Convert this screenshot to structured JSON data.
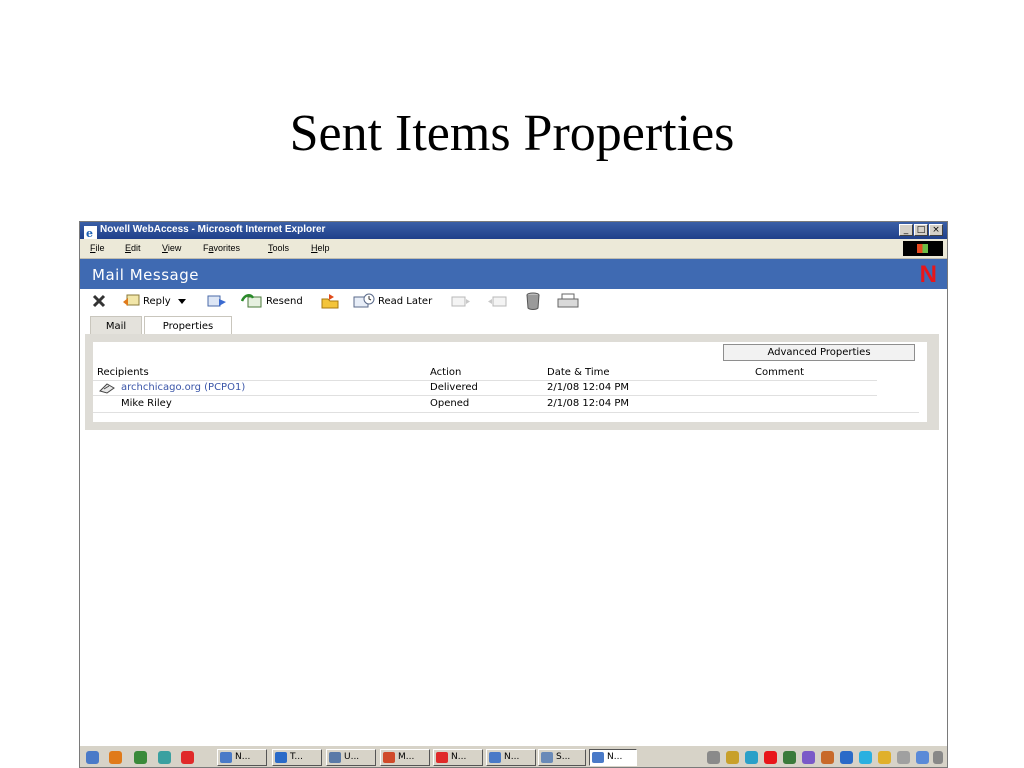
{
  "slide": {
    "title": "Sent Items Properties"
  },
  "window": {
    "title": "Novell WebAccess - Microsoft Internet Explorer",
    "min": "_",
    "max": "□",
    "close": "×"
  },
  "menu": [
    {
      "u": "F",
      "rest": "ile"
    },
    {
      "u": "E",
      "rest": "dit"
    },
    {
      "u": "V",
      "rest": "iew"
    },
    {
      "pre": "F",
      "u": "a",
      "rest": "vorites"
    },
    {
      "u": "T",
      "rest": "ools"
    },
    {
      "u": "H",
      "rest": "elp"
    }
  ],
  "app": {
    "header": "Mail Message",
    "logo": "N"
  },
  "toolbar": {
    "reply": "Reply",
    "resend": "Resend",
    "read_later": "Read Later"
  },
  "tabs": {
    "mail": "Mail",
    "properties": "Properties"
  },
  "properties": {
    "advanced_button": "Advanced Properties",
    "headers": {
      "recipients": "Recipients",
      "action": "Action",
      "datetime": "Date & Time",
      "comment": "Comment"
    },
    "rows": [
      {
        "recipient": "archchicago.org (PCPO1)",
        "action": "Delivered",
        "datetime": "2/1/08 12:04 PM"
      },
      {
        "recipient": "Mike Riley",
        "action": "Opened",
        "datetime": "2/1/08 12:04 PM"
      }
    ]
  },
  "taskbar": {
    "buttons": [
      "N...",
      "T...",
      "U...",
      "M...",
      "N...",
      "N...",
      "S...",
      "N..."
    ]
  },
  "colors": {
    "titlebar": "#1f3f8a",
    "app_header": "#3f6ab2",
    "novell_red": "#e8161a",
    "link": "#3a55a8"
  }
}
